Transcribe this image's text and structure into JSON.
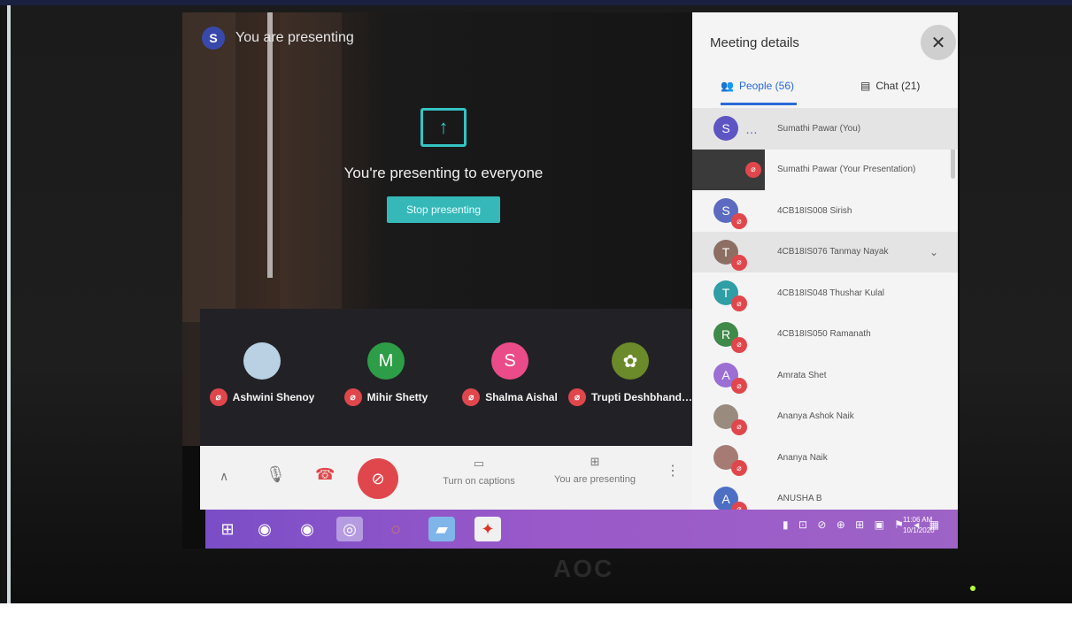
{
  "meet": {
    "presenting_banner": "You are presenting",
    "presenter_initial": "S",
    "center_message": "You're presenting to everyone",
    "stop_button": "Stop presenting",
    "tiles": [
      {
        "initial": "",
        "name": "Ashwini Shenoy",
        "color": "#b9d1e3"
      },
      {
        "initial": "M",
        "name": "Mihir Shetty",
        "color": "#2e9d47"
      },
      {
        "initial": "S",
        "name": "Shalma Aishal",
        "color": "#ea4c89"
      },
      {
        "initial": "",
        "name": "Trupti Deshbhand…",
        "color": "#6b8a2a"
      }
    ],
    "controls": {
      "captions_label": "Turn on captions",
      "presenting_label": "You are presenting"
    }
  },
  "panel": {
    "title": "Meeting details",
    "close_glyph": "✕",
    "people_tab": "People (56)",
    "chat_tab": "Chat (21)",
    "people": [
      {
        "initial": "S",
        "name": "Sumathi Pawar (You)",
        "color": "#5e55c4",
        "muted": false,
        "extra": "…"
      },
      {
        "initial": "",
        "name": "Sumathi Pawar (Your Presentation)",
        "color": "#3a3a3a",
        "muted": true,
        "extra": ""
      },
      {
        "initial": "S",
        "name": "4CB18IS008 Sirish",
        "color": "#5c6bc0",
        "muted": true,
        "extra": ""
      },
      {
        "initial": "T",
        "name": "4CB18IS076 Tanmay Nayak",
        "color": "#8d6e63",
        "muted": true,
        "extra": ""
      },
      {
        "initial": "T",
        "name": "4CB18IS048 Thushar Kulal",
        "color": "#2f9ea5",
        "muted": true,
        "extra": ""
      },
      {
        "initial": "R",
        "name": "4CB18IS050 Ramanath",
        "color": "#3f8a4a",
        "muted": true,
        "extra": ""
      },
      {
        "initial": "A",
        "name": "Amrata Shet",
        "color": "#9b6fd3",
        "muted": true,
        "extra": ""
      },
      {
        "initial": "",
        "name": "Ananya Ashok Naik",
        "color": "#9a8b7f",
        "muted": true,
        "extra": ""
      },
      {
        "initial": "",
        "name": "Ananya Naik",
        "color": "#a57b74",
        "muted": true,
        "extra": ""
      },
      {
        "initial": "A",
        "name": "ANUSHA B",
        "color": "#4c6fc4",
        "muted": true,
        "extra": ""
      }
    ]
  },
  "taskbar": {
    "time": "11:06 AM",
    "date": "10/1/2020"
  },
  "monitor": {
    "brand": "AOC"
  }
}
